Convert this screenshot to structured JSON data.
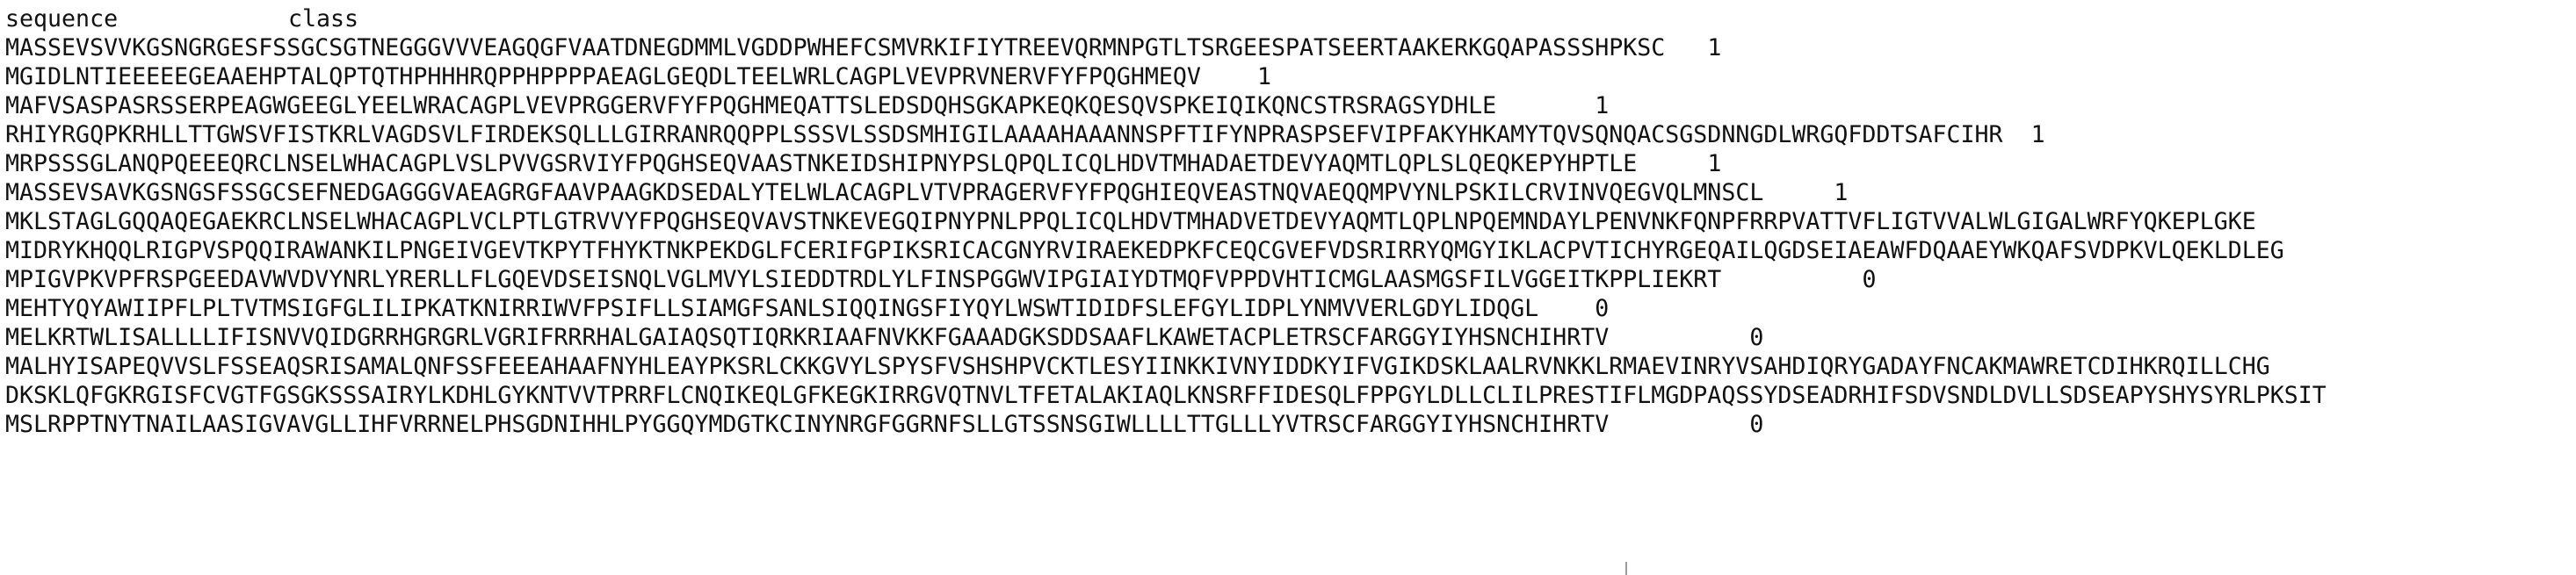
{
  "header": {
    "sequence_label": "sequence",
    "class_label": "class"
  },
  "rows": [
    {
      "sequence": "MASSEVSVVKGSNGRGESFSSGCSGTNEGGGVVVEAGQGFVAATDNEGDMMLVGDDPWHEFCSMVRKIFIYTREEVQRMNPGTLTSRGEESPATSEERTAAKERKGQAPASSSHPKSC",
      "class": "1"
    },
    {
      "sequence": "MGIDLNTIEEEEEGEAAEHPTALQPTQTHPHHHRQPPHPPPPAEAGLGEQDLTEELWRLCAGPLVEVPRVNERVFYFPQGHMEQV",
      "class": "1"
    },
    {
      "sequence": "MAFVSASPASRSSERPEAGWGEEGLYEELWRACAGPLVEVPRGGERVFYFPQGHMEQATTSLEDSDQHSGKAPKEQKQESQVSPKEIQIKQNCSTRSRAGSYDHLE",
      "class": "1"
    },
    {
      "sequence": "RHIYRGQPKRHLLTTGWSVFISTKRLVAGDSVLFIRDEKSQLLLGIRRANRQQPPLSSSVLSSDSMHIGILAAAAHAAANNSPFTIFYNPRASPSEFVIPFAKYHKAMYTQVSQNQACSGSDNNGDLWRGQFDDTSAFCIHR",
      "class": "1"
    },
    {
      "sequence": "MRPSSSGLANQPQEEEQRCLNSELWHACAGPLVSLPVVGSRVIYFPQGHSEQVAASTNKEIDSHIPNYPSLQPQLICQLHDVTMHADAETDEVYAQMTLQPLSLQEQKEPYHPTLE",
      "class": "1"
    },
    {
      "sequence": "MASSEVSAVKGSNGSFSSGCSEFNEDGAGGGVAEAGRGFAAVPAAGKDSEDALYTELWLACAGPLVTVPRAGERVFYFPQGHIEQVEASTNQVAEQQMPVYNLPSKILCRVINVQEGVQLMNSCL",
      "class": "1"
    },
    {
      "sequence": "MKLSTAGLGQQAQEGAEKRCLNSELWHACAGPLVCLPTLGTRVVYFPQGHSEQVAVSTNKEVEGQIPNYPNLPPQLICQLHDVTMHADVETDEVYAQMTLQPLNPQEMNDAYLPENVNKFQNPFRRPVATTVFLIGTVVALWLGIGALWRFYQKEPLGKE",
      "class": ""
    },
    {
      "sequence": "MIDRYKHQQLRIGPVSPQQIRAWANKILPNGEIVGEVTKPYTFHYKTNKPEKDGLFCERIFGPIKSRICACGNYRVIRAEKEDPKFCEQCGVEFVDSRIRRYQMGYIKLACPVTICHYRGEQAILQGDSEIAEAWFDQAAEYWKQAFSVDPKVLQEKLDLEG",
      "class": ""
    },
    {
      "sequence": "MPIGVPKVPFRSPGEEDAVWVDVYNRLYRERLLFLGQEVDSEISNQLVGLMVYLSIEDDTRDLYLFINSPGGWVIPGIAIYDTMQFVPPDVHTICMGLAASMGSFILVGGEITKPPLIEKRT",
      "class": "0"
    },
    {
      "sequence": "MEHTYQYAWIIPFLPLTVTMSIGFGLILIPKATKNIRRIWVFPSIFLLSIAMGFSANLSIQQINGSFIYQYLWSWTIDIDFSLEFGYLIDPLYNMVVERLGDYLIDQGL",
      "class": "0"
    },
    {
      "sequence": "MELKRTWLISALLLLIFISNVVQIDGRRHGRGRLVGRIFRRRHALGAIAQSQTIQRKRIAAFNVKKFGAAADGKSDDSAAFLKAWETACPLETRSCFARGGYIYHSNCHIHRTV",
      "class": "0"
    },
    {
      "sequence": "MALHYISAPEQVVSLFSSEAQSRISAMALQNFSSFEEEAHAAFNYHLEAYPKSRLCKKGVYLSPYSFVSHSHPVCKTLESYIINKKIVNYIDDKYIFVGIKDSKLAALRVNKKLRMAEVINRYVSAHDIQRYGADAYFNCAKMAWRETCDIHKRQILLCHG",
      "class": ""
    },
    {
      "sequence": "DKSKLQFGKRGISFCVGTFGSGKSSSAIRYLKDHLGYKNTVVTPRRFLCNQIKEQLGFKEGKIRRGVQTNVLTFETALAKIAQLKNSRFFIDESQLFPPGYLDLLCLILPRESTIFLMGDPAQSSYDSEADRHIFSDVSNDLDVLLSDSEAPYSHYSYRLPKSIT",
      "class": ""
    },
    {
      "sequence": "MSLRPPTNYTNAILAASIGVAVGLLIHFVRRNELPHSGDNIHHLPYGGQYMDGTKCINYNRGFGGRNFSLLGTSSNSGIWLLLLTTGLLLYVTRSCFARGGYIYHSNCHIHRTV",
      "class": "0"
    }
  ]
}
